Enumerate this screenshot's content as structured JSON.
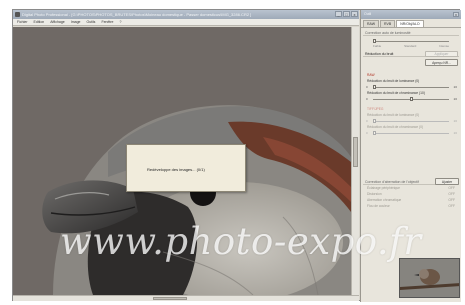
{
  "window": {
    "title": "Digital Photo Professional - [G:\\PHOTOS\\PHOTOS_BRUTES\\Photos\\Moineau domestique - Passer domesticus\\IMG_3286.CR2 ]",
    "min": "_",
    "max": "□",
    "close": "x"
  },
  "menu": [
    "Fichier",
    "Edition",
    "Affichage",
    "Image",
    "Outils",
    "Fenêtre",
    "?"
  ],
  "dialog": {
    "message": "Redéveloppe des images... (0/1)"
  },
  "watermark": "www.photo-expo.fr",
  "panel": {
    "title": "Outil",
    "close": "x",
    "tabs": [
      "RAW",
      "RVB",
      "NR/Obj/ALO"
    ],
    "active_tab": 2,
    "section1": {
      "header": "Correction auto de luminosité",
      "ticks": [
        "Faible",
        "Standard",
        "Intense"
      ]
    },
    "noise": {
      "header": "Réduction du bruit",
      "apply": "Appliquer",
      "preview": "Aperçu NR...",
      "raw_label": "RAW",
      "lum_label": "Réduction du bruit de luminance (0)",
      "chroma_label": "Réduction du bruit de chrominance (10)",
      "tiff_label": "TIFF/JPEG",
      "tiff_lum_label": "Réduction du bruit de luminance (0)",
      "tiff_chroma_label": "Réduction du bruit de chrominance (0)",
      "min": "0",
      "max": "20",
      "raw_lum_value": 0,
      "raw_chroma_value": 10,
      "tiff_lum_value": 0,
      "tiff_chroma_value": 0
    },
    "lens": {
      "header": "Correction d'aberration de l'objectif",
      "button": "Ajuster",
      "rows": [
        {
          "label": "Éclairage périphérique",
          "value": "OFF"
        },
        {
          "label": "Distorsion",
          "value": "OFF"
        },
        {
          "label": "Aberration chromatique",
          "value": "OFF"
        },
        {
          "label": "Flou de couleur",
          "value": "OFF"
        }
      ]
    }
  }
}
